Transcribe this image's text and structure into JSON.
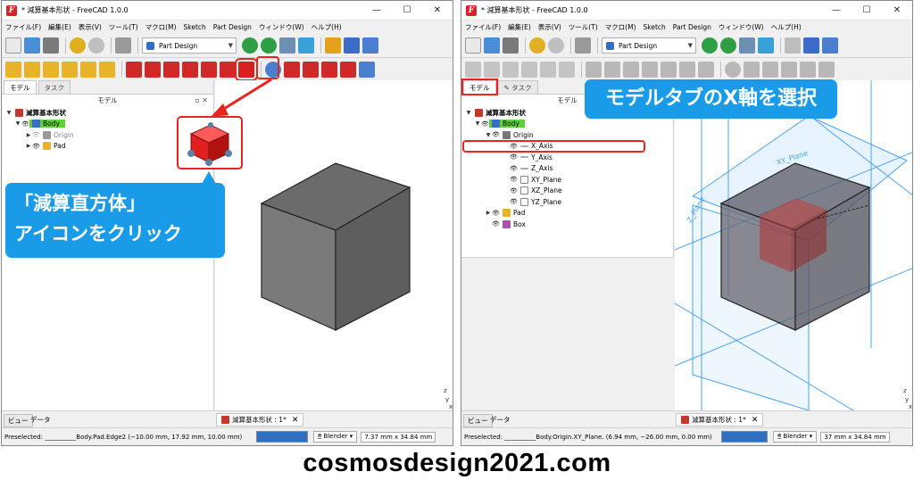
{
  "colors": {
    "accent_red": "#e8251f",
    "callout_blue": "#1a9be8",
    "body_highlight": "#5fcf3a",
    "cube": "#6e6e6e"
  },
  "left_window": {
    "title": "* 減算基本形状 - FreeCAD 1.0.0",
    "window_buttons": [
      "—",
      "☐",
      "✕"
    ],
    "menu": [
      "ファイル(F)",
      "編集(E)",
      "表示(V)",
      "ツール(T)",
      "マクロ(M)",
      "Sketch",
      "Part Design",
      "ウィンドウ(W)",
      "ヘルプ(H)"
    ],
    "workbench": "Part Design",
    "tabs": [
      "モデル",
      "タスク"
    ],
    "pane_title": "モデル",
    "tree": [
      {
        "label": "減算基本形状"
      },
      {
        "label": "Body"
      },
      {
        "label": "Origin"
      },
      {
        "label": "Pad"
      }
    ],
    "doc_tabs": [
      "ビュー",
      "データ"
    ],
    "doc_tab_name": "減算基本形状 : 1*",
    "status_text": "Preselected: __________Body.Pad.Edge2 (−10.00 mm, 17.92 mm, 10.00 mm)",
    "nav_style": "Blender",
    "dimensions": "7.37 mm x 34.84 mm",
    "callout": [
      "「減算直方体」",
      "アイコンをクリック"
    ]
  },
  "right_window": {
    "title": "* 減算基本形状 - FreeCAD 1.0.0",
    "window_buttons": [
      "—",
      "☐",
      "✕"
    ],
    "menu": [
      "ファイル(F)",
      "編集(E)",
      "表示(V)",
      "ツール(T)",
      "マクロ(M)",
      "Sketch",
      "Part Design",
      "ウィンドウ(W)",
      "ヘルプ(H)"
    ],
    "workbench": "Part Design",
    "tabs": [
      "モデル",
      "タスク"
    ],
    "pane_title": "モデル",
    "tree": [
      {
        "label": "減算基本形状"
      },
      {
        "label": "Body"
      },
      {
        "label": "Origin"
      },
      {
        "label": "X_Axis"
      },
      {
        "label": "Y_Axis"
      },
      {
        "label": "Z_Axis"
      },
      {
        "label": "XY_Plane"
      },
      {
        "label": "XZ_Plane"
      },
      {
        "label": "YZ_Plane"
      },
      {
        "label": "Pad"
      },
      {
        "label": "Box"
      }
    ],
    "plane_labels": [
      "XY_Plane",
      "Z_Plane"
    ],
    "doc_tabs": [
      "ビュー",
      "データ"
    ],
    "doc_tab_name": "減算基本形状 : 1*",
    "status_text": "Preselected: __________Body.Origin.XY_Plane. (6.94 mm, −26.00 mm, 0.00 mm)",
    "nav_style": "Blender",
    "dimensions": "37 mm x 34.84 mm",
    "callout": "モデルタブのX軸を選択"
  },
  "footer": "cosmosdesign2021.com"
}
